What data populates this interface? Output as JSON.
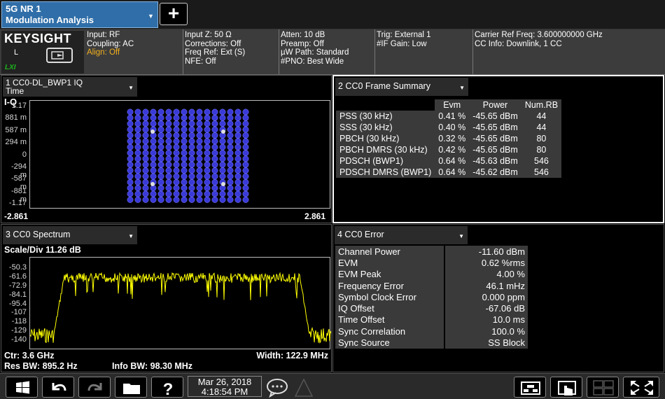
{
  "app": {
    "mode_line1": "5G NR 1",
    "mode_line2": "Modulation Analysis",
    "add_tab": "+"
  },
  "header": {
    "brand": "KEYSIGHT",
    "local_label": "L",
    "lxi_label": "LXI",
    "input": "Input: RF",
    "coupling": "Coupling: AC",
    "align": "Align: Off",
    "input_z": "Input Z: 50 Ω",
    "corrections": "Corrections: Off",
    "freq_ref": "Freq Ref: Ext (S)",
    "nfe": "NFE: Off",
    "atten": "Atten: 10 dB",
    "preamp": "Preamp: Off",
    "uw_path": "µW Path: Standard",
    "pno": "#PNO: Best Wide",
    "trig": "Trig: External 1",
    "if_gain": "#IF Gain: Low",
    "carrier_ref_freq": "Carrier Ref Freq: 3.600000000 GHz",
    "cc_info": "CC Info: Downlink, 1 CC"
  },
  "window1": {
    "title_line1": "1 CC0-DL_BWP1 IQ",
    "title_line2": "Time",
    "axis_label": "I-Q",
    "y_ticks": [
      "1.17",
      "881 m",
      "587 m",
      "294 m",
      "0",
      "-294 m",
      "-587 m",
      "-881 m",
      "-1.17"
    ],
    "x_min": "-2.861",
    "x_max": "2.861",
    "constellation": {
      "grid_size": 16,
      "point_color": "#3a3ad8"
    }
  },
  "window2": {
    "title": "2 CC0 Frame Summary",
    "columns": [
      "",
      "Evm",
      "Power",
      "Num.RB"
    ],
    "rows": [
      {
        "name": "PSS (30 kHz)",
        "evm": "0.41 %",
        "power": "-45.65 dBm",
        "rb": "44"
      },
      {
        "name": "SSS (30 kHz)",
        "evm": "0.40 %",
        "power": "-45.65 dBm",
        "rb": "44"
      },
      {
        "name": "PBCH (30 kHz)",
        "evm": "0.32 %",
        "power": "-45.65 dBm",
        "rb": "80"
      },
      {
        "name": "PBCH DMRS (30 kHz)",
        "evm": "0.42 %",
        "power": "-45.65 dBm",
        "rb": "80"
      },
      {
        "name": "PDSCH (BWP1)",
        "evm": "0.64 %",
        "power": "-45.63 dBm",
        "rb": "546"
      },
      {
        "name": "PDSCH DMRS (BWP1)",
        "evm": "0.64 %",
        "power": "-45.62 dBm",
        "rb": "546"
      }
    ]
  },
  "window3": {
    "title": "3 CC0 Spectrum",
    "scale_div": "Scale/Div 11.26 dB",
    "y_ticks": [
      "-50.3",
      "-61.6",
      "-72.9",
      "-84.1",
      "-95.4",
      "-107",
      "-118",
      "-129",
      "-140"
    ],
    "ctr": "Ctr: 3.6 GHz",
    "width": "Width: 122.9 MHz",
    "res_bw": "Res BW: 895.2 Hz",
    "info_bw": "Info BW: 98.30 MHz",
    "trace_color": "#ffff00"
  },
  "window4": {
    "title": "4 CC0 Error",
    "rows": [
      {
        "label": "Channel Power",
        "value": "-11.60 dBm"
      },
      {
        "label": "EVM",
        "value": "0.62 %rms"
      },
      {
        "label": "EVM Peak",
        "value": "4.00 %"
      },
      {
        "label": "Frequency Error",
        "value": "46.1 mHz"
      },
      {
        "label": "Symbol Clock Error",
        "value": "0.000 ppm"
      },
      {
        "label": "IQ Offset",
        "value": "-67.06 dB"
      },
      {
        "label": "Time Offset",
        "value": "10.0 ms"
      },
      {
        "label": "Sync Correlation",
        "value": "100.0 %"
      },
      {
        "label": "Sync Source",
        "value": "SS Block"
      }
    ]
  },
  "taskbar": {
    "date": "Mar 26, 2018",
    "time": "4:18:54 PM",
    "icons": [
      "windows-icon",
      "undo-icon",
      "redo-icon",
      "folder-icon",
      "help-icon",
      "chat-icon",
      "alert-triangle-icon",
      "layout-icon",
      "touch-icon",
      "multi-window-icon",
      "maximize-icon"
    ]
  }
}
